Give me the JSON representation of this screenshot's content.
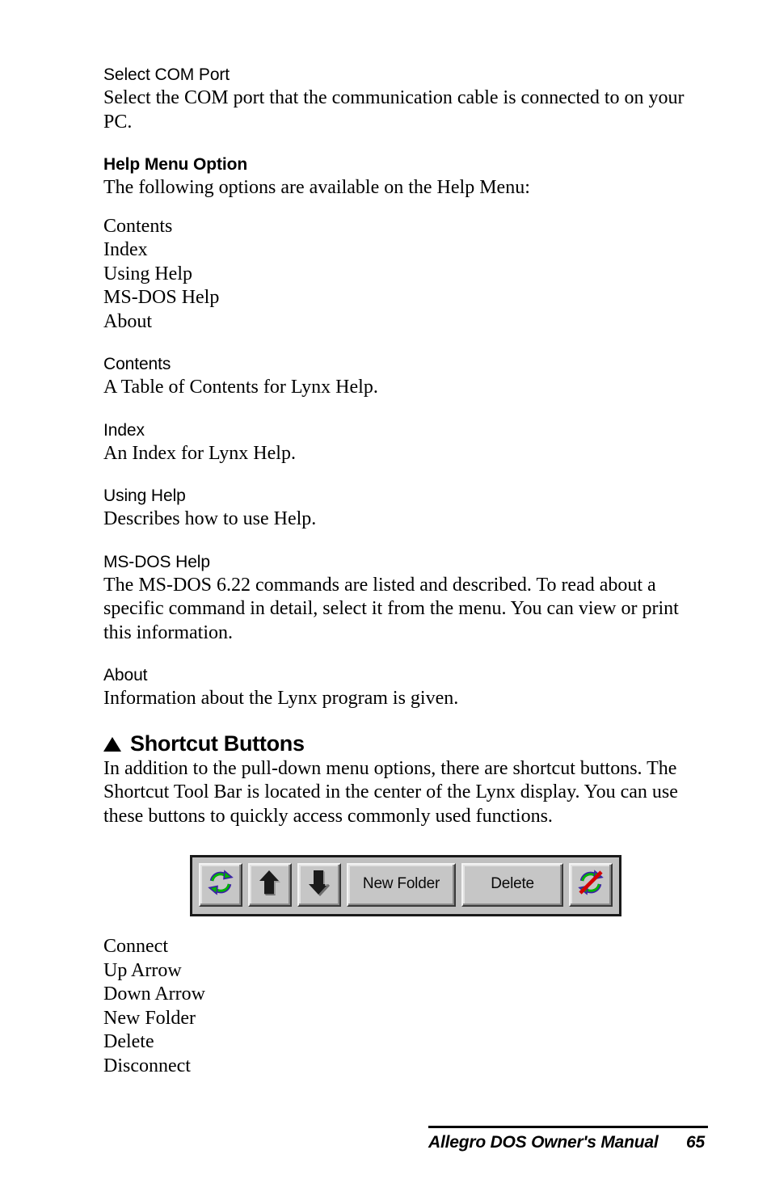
{
  "document": {
    "title": "Allegro DOS Owner's Manual",
    "page_number": "65"
  },
  "sections": {
    "select_com_port": {
      "heading": "Select COM Port",
      "body": "Select the COM port that the communication cable is connected to on your PC."
    },
    "help_menu_option": {
      "heading": "Help Menu Option",
      "intro": "The following options are available on the Help Menu:",
      "options": [
        "Contents",
        "Index",
        "Using Help",
        "MS-DOS Help",
        "About"
      ]
    },
    "contents": {
      "heading": "Contents",
      "body": "A Table of Contents for Lynx Help."
    },
    "index": {
      "heading": "Index",
      "body": "An Index for Lynx Help."
    },
    "using_help": {
      "heading": "Using Help",
      "body": "Describes how to use Help."
    },
    "ms_dos_help": {
      "heading": "MS-DOS Help",
      "body": "The MS-DOS 6.22 commands are listed and described. To read about a specific command in detail, select it from the menu. You can view or print this information."
    },
    "about": {
      "heading": "About",
      "body": "Information about the Lynx program is given."
    },
    "shortcut_buttons": {
      "heading": "Shortcut Buttons",
      "bullet": "▲",
      "body": "In addition to the pull-down menu options, there are shortcut buttons. The Shortcut Tool Bar is located in the center of the Lynx display. You can use these buttons to quickly access commonly used functions.",
      "button_names": [
        "Connect",
        "Up Arrow",
        "Down Arrow",
        "New Folder",
        "Delete",
        "Disconnect"
      ]
    }
  },
  "toolbar_figure": {
    "buttons": [
      {
        "name": "connect",
        "type": "icon",
        "icon": "refresh-cycle-icon",
        "label": ""
      },
      {
        "name": "up-arrow",
        "type": "icon",
        "icon": "arrow-up-icon",
        "label": ""
      },
      {
        "name": "down-arrow",
        "type": "icon",
        "icon": "arrow-down-icon",
        "label": ""
      },
      {
        "name": "new-folder",
        "type": "text",
        "icon": "",
        "label": "New Folder"
      },
      {
        "name": "delete",
        "type": "text",
        "icon": "",
        "label": "Delete"
      },
      {
        "name": "disconnect",
        "type": "icon",
        "icon": "refresh-cycle-slashed-icon",
        "label": ""
      }
    ],
    "colors": {
      "face": "#c6c6c6",
      "frame": "#1a1a1a",
      "icon_green": "#00b400",
      "icon_blue": "#3b1fa8",
      "slash_red": "#d40000",
      "arrow_black": "#1a1a1a"
    }
  }
}
